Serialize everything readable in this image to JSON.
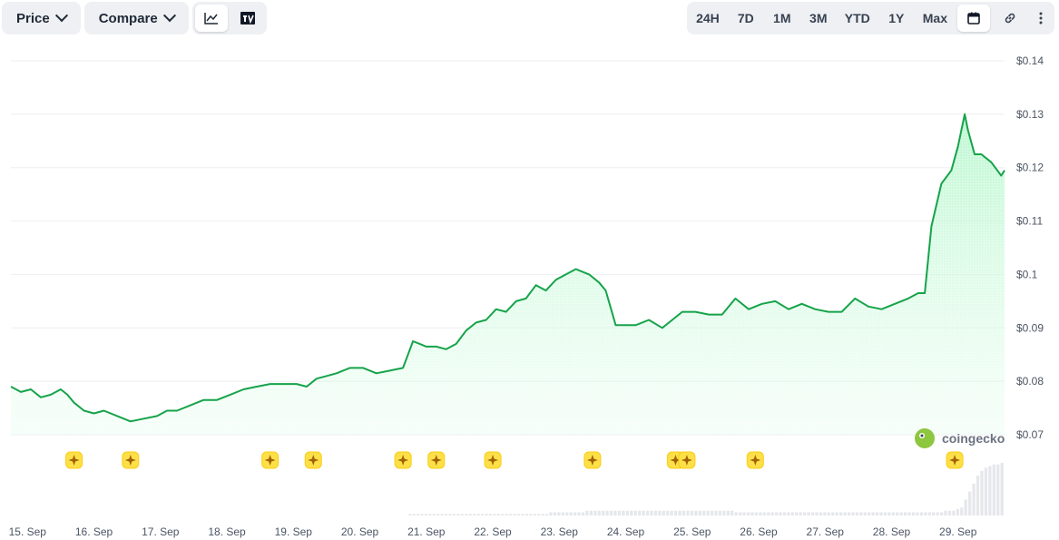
{
  "toolbar": {
    "price_label": "Price",
    "compare_label": "Compare",
    "chart_type_icons": [
      "line-chart-icon",
      "tradingview-icon"
    ],
    "ranges": [
      "24H",
      "7D",
      "1M",
      "3M",
      "YTD",
      "1Y",
      "Max"
    ],
    "tool_icons": [
      "calendar-icon",
      "link-icon",
      "more-icon"
    ]
  },
  "watermark": "coingecko",
  "colors": {
    "line": "#16a34a",
    "area": "#dcfce7",
    "event_marker": "#fde047",
    "grid": "#eceef1",
    "volume": "#e5e7eb"
  },
  "chart_data": {
    "type": "area",
    "ylim": [
      0.07,
      0.14
    ],
    "yticks": [
      {
        "value": 0.14,
        "label": "$0.14"
      },
      {
        "value": 0.13,
        "label": "$0.13"
      },
      {
        "value": 0.12,
        "label": "$0.12"
      },
      {
        "value": 0.11,
        "label": "$0.11"
      },
      {
        "value": 0.1,
        "label": "$0.1"
      },
      {
        "value": 0.09,
        "label": "$0.09"
      },
      {
        "value": 0.08,
        "label": "$0.08"
      },
      {
        "value": 0.07,
        "label": "$0.07"
      }
    ],
    "xlim": [
      0,
      14.95
    ],
    "xticks": [
      {
        "value": 0.25,
        "label": "15. Sep"
      },
      {
        "value": 1.25,
        "label": "16. Sep"
      },
      {
        "value": 2.25,
        "label": "17. Sep"
      },
      {
        "value": 3.25,
        "label": "18. Sep"
      },
      {
        "value": 4.25,
        "label": "19. Sep"
      },
      {
        "value": 5.25,
        "label": "20. Sep"
      },
      {
        "value": 6.25,
        "label": "21. Sep"
      },
      {
        "value": 7.25,
        "label": "22. Sep"
      },
      {
        "value": 8.25,
        "label": "23. Sep"
      },
      {
        "value": 9.25,
        "label": "24. Sep"
      },
      {
        "value": 10.25,
        "label": "25. Sep"
      },
      {
        "value": 11.25,
        "label": "26. Sep"
      },
      {
        "value": 12.25,
        "label": "27. Sep"
      },
      {
        "value": 13.25,
        "label": "28. Sep"
      },
      {
        "value": 14.25,
        "label": "29. Sep"
      }
    ],
    "price": {
      "x": [
        0,
        0.15,
        0.3,
        0.45,
        0.6,
        0.75,
        0.85,
        0.95,
        1.1,
        1.25,
        1.4,
        1.6,
        1.8,
        2.0,
        2.2,
        2.35,
        2.5,
        2.7,
        2.9,
        3.1,
        3.3,
        3.5,
        3.7,
        3.9,
        4.1,
        4.3,
        4.45,
        4.6,
        4.75,
        4.9,
        5.1,
        5.3,
        5.5,
        5.7,
        5.9,
        6.05,
        6.15,
        6.25,
        6.4,
        6.55,
        6.7,
        6.85,
        7.0,
        7.15,
        7.3,
        7.45,
        7.6,
        7.75,
        7.9,
        8.05,
        8.2,
        8.35,
        8.5,
        8.7,
        8.85,
        8.95,
        9.1,
        9.25,
        9.4,
        9.6,
        9.8,
        9.95,
        10.1,
        10.3,
        10.5,
        10.7,
        10.9,
        11.1,
        11.3,
        11.5,
        11.7,
        11.9,
        12.1,
        12.3,
        12.5,
        12.7,
        12.9,
        13.1,
        13.3,
        13.5,
        13.65,
        13.75,
        13.85,
        14.0,
        14.15,
        14.25,
        14.35,
        14.4,
        14.5,
        14.6,
        14.75,
        14.9,
        14.95
      ],
      "y": [
        0.079,
        0.078,
        0.0785,
        0.077,
        0.0775,
        0.0785,
        0.0775,
        0.076,
        0.0745,
        0.074,
        0.0745,
        0.0735,
        0.0725,
        0.073,
        0.0735,
        0.0745,
        0.0745,
        0.0755,
        0.0765,
        0.0765,
        0.0775,
        0.0785,
        0.079,
        0.0795,
        0.0795,
        0.0795,
        0.079,
        0.0805,
        0.081,
        0.0815,
        0.0825,
        0.0825,
        0.0815,
        0.082,
        0.0825,
        0.0875,
        0.087,
        0.0865,
        0.0865,
        0.086,
        0.087,
        0.0895,
        0.091,
        0.0915,
        0.0935,
        0.093,
        0.095,
        0.0955,
        0.098,
        0.097,
        0.099,
        0.1,
        0.101,
        0.1,
        0.0985,
        0.097,
        0.0905,
        0.0905,
        0.0905,
        0.0915,
        0.09,
        0.0915,
        0.093,
        0.093,
        0.0925,
        0.0925,
        0.0955,
        0.0935,
        0.0945,
        0.095,
        0.0935,
        0.0945,
        0.0935,
        0.093,
        0.093,
        0.0955,
        0.094,
        0.0935,
        0.0945,
        0.0955,
        0.0965,
        0.0965,
        0.109,
        0.117,
        0.1195,
        0.124,
        0.13,
        0.127,
        0.1225,
        0.1225,
        0.121,
        0.1185,
        0.1195
      ]
    },
    "event_markers": [
      0.95,
      1.8,
      3.9,
      4.55,
      5.9,
      6.4,
      7.25,
      8.75,
      10.0,
      10.17,
      11.2,
      14.2
    ],
    "volume": [
      1,
      1,
      1,
      1,
      1,
      1,
      1,
      1,
      1,
      1,
      1,
      1,
      1,
      1,
      1,
      1,
      1,
      1,
      1,
      1,
      1,
      1,
      1,
      1,
      1,
      1,
      1,
      1,
      1,
      1,
      1,
      1,
      1,
      1,
      1,
      2,
      2,
      2,
      2,
      2,
      2,
      2,
      2,
      2,
      3,
      3,
      3,
      3,
      3,
      3,
      3,
      3,
      3,
      3,
      3,
      3,
      3,
      3,
      3,
      3,
      3,
      3,
      3,
      3,
      3,
      3,
      3,
      3,
      3,
      3,
      3,
      3,
      3,
      3,
      3,
      3,
      3,
      3,
      3,
      3,
      3,
      2,
      2,
      2,
      2,
      2,
      2,
      2,
      2,
      2,
      2,
      2,
      2,
      2,
      2,
      2,
      2,
      2,
      2,
      2,
      2,
      2,
      2,
      2,
      2,
      2,
      2,
      2,
      2,
      2,
      2,
      2,
      2,
      2,
      2,
      2,
      2,
      2,
      2,
      2,
      2,
      2,
      2,
      2,
      2,
      2,
      2,
      2,
      2,
      2,
      2,
      2,
      2,
      3,
      3,
      3,
      4,
      5,
      10,
      15,
      20,
      25,
      28,
      30,
      31,
      32,
      32,
      33
    ]
  }
}
